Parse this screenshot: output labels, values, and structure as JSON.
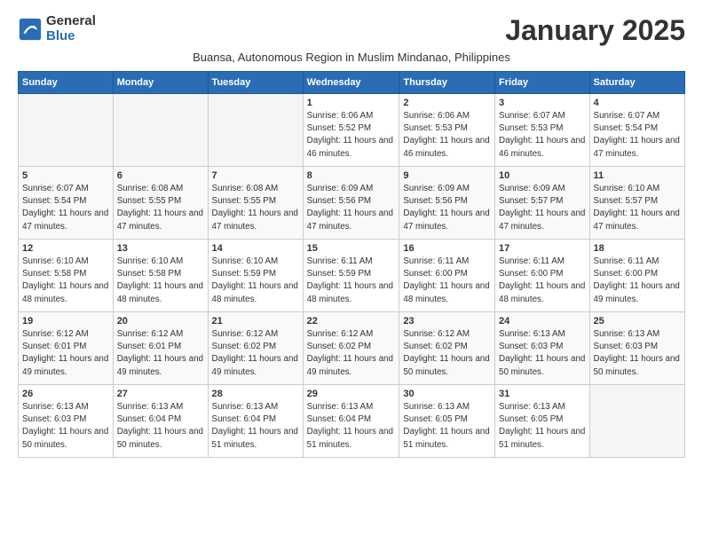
{
  "logo": {
    "general": "General",
    "blue": "Blue"
  },
  "title": "January 2025",
  "subtitle": "Buansa, Autonomous Region in Muslim Mindanao, Philippines",
  "headers": [
    "Sunday",
    "Monday",
    "Tuesday",
    "Wednesday",
    "Thursday",
    "Friday",
    "Saturday"
  ],
  "weeks": [
    [
      {
        "day": "",
        "info": ""
      },
      {
        "day": "",
        "info": ""
      },
      {
        "day": "",
        "info": ""
      },
      {
        "day": "1",
        "info": "Sunrise: 6:06 AM\nSunset: 5:52 PM\nDaylight: 11 hours and 46 minutes."
      },
      {
        "day": "2",
        "info": "Sunrise: 6:06 AM\nSunset: 5:53 PM\nDaylight: 11 hours and 46 minutes."
      },
      {
        "day": "3",
        "info": "Sunrise: 6:07 AM\nSunset: 5:53 PM\nDaylight: 11 hours and 46 minutes."
      },
      {
        "day": "4",
        "info": "Sunrise: 6:07 AM\nSunset: 5:54 PM\nDaylight: 11 hours and 47 minutes."
      }
    ],
    [
      {
        "day": "5",
        "info": "Sunrise: 6:07 AM\nSunset: 5:54 PM\nDaylight: 11 hours and 47 minutes."
      },
      {
        "day": "6",
        "info": "Sunrise: 6:08 AM\nSunset: 5:55 PM\nDaylight: 11 hours and 47 minutes."
      },
      {
        "day": "7",
        "info": "Sunrise: 6:08 AM\nSunset: 5:55 PM\nDaylight: 11 hours and 47 minutes."
      },
      {
        "day": "8",
        "info": "Sunrise: 6:09 AM\nSunset: 5:56 PM\nDaylight: 11 hours and 47 minutes."
      },
      {
        "day": "9",
        "info": "Sunrise: 6:09 AM\nSunset: 5:56 PM\nDaylight: 11 hours and 47 minutes."
      },
      {
        "day": "10",
        "info": "Sunrise: 6:09 AM\nSunset: 5:57 PM\nDaylight: 11 hours and 47 minutes."
      },
      {
        "day": "11",
        "info": "Sunrise: 6:10 AM\nSunset: 5:57 PM\nDaylight: 11 hours and 47 minutes."
      }
    ],
    [
      {
        "day": "12",
        "info": "Sunrise: 6:10 AM\nSunset: 5:58 PM\nDaylight: 11 hours and 48 minutes."
      },
      {
        "day": "13",
        "info": "Sunrise: 6:10 AM\nSunset: 5:58 PM\nDaylight: 11 hours and 48 minutes."
      },
      {
        "day": "14",
        "info": "Sunrise: 6:10 AM\nSunset: 5:59 PM\nDaylight: 11 hours and 48 minutes."
      },
      {
        "day": "15",
        "info": "Sunrise: 6:11 AM\nSunset: 5:59 PM\nDaylight: 11 hours and 48 minutes."
      },
      {
        "day": "16",
        "info": "Sunrise: 6:11 AM\nSunset: 6:00 PM\nDaylight: 11 hours and 48 minutes."
      },
      {
        "day": "17",
        "info": "Sunrise: 6:11 AM\nSunset: 6:00 PM\nDaylight: 11 hours and 48 minutes."
      },
      {
        "day": "18",
        "info": "Sunrise: 6:11 AM\nSunset: 6:00 PM\nDaylight: 11 hours and 49 minutes."
      }
    ],
    [
      {
        "day": "19",
        "info": "Sunrise: 6:12 AM\nSunset: 6:01 PM\nDaylight: 11 hours and 49 minutes."
      },
      {
        "day": "20",
        "info": "Sunrise: 6:12 AM\nSunset: 6:01 PM\nDaylight: 11 hours and 49 minutes."
      },
      {
        "day": "21",
        "info": "Sunrise: 6:12 AM\nSunset: 6:02 PM\nDaylight: 11 hours and 49 minutes."
      },
      {
        "day": "22",
        "info": "Sunrise: 6:12 AM\nSunset: 6:02 PM\nDaylight: 11 hours and 49 minutes."
      },
      {
        "day": "23",
        "info": "Sunrise: 6:12 AM\nSunset: 6:02 PM\nDaylight: 11 hours and 50 minutes."
      },
      {
        "day": "24",
        "info": "Sunrise: 6:13 AM\nSunset: 6:03 PM\nDaylight: 11 hours and 50 minutes."
      },
      {
        "day": "25",
        "info": "Sunrise: 6:13 AM\nSunset: 6:03 PM\nDaylight: 11 hours and 50 minutes."
      }
    ],
    [
      {
        "day": "26",
        "info": "Sunrise: 6:13 AM\nSunset: 6:03 PM\nDaylight: 11 hours and 50 minutes."
      },
      {
        "day": "27",
        "info": "Sunrise: 6:13 AM\nSunset: 6:04 PM\nDaylight: 11 hours and 50 minutes."
      },
      {
        "day": "28",
        "info": "Sunrise: 6:13 AM\nSunset: 6:04 PM\nDaylight: 11 hours and 51 minutes."
      },
      {
        "day": "29",
        "info": "Sunrise: 6:13 AM\nSunset: 6:04 PM\nDaylight: 11 hours and 51 minutes."
      },
      {
        "day": "30",
        "info": "Sunrise: 6:13 AM\nSunset: 6:05 PM\nDaylight: 11 hours and 51 minutes."
      },
      {
        "day": "31",
        "info": "Sunrise: 6:13 AM\nSunset: 6:05 PM\nDaylight: 11 hours and 51 minutes."
      },
      {
        "day": "",
        "info": ""
      }
    ]
  ]
}
